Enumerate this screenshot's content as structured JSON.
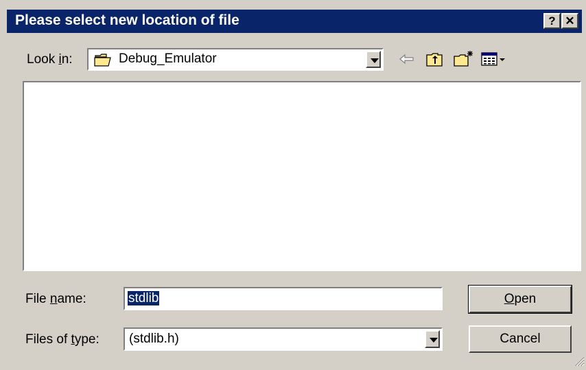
{
  "title_bar": {
    "title": "Please select new location of file",
    "help_label": "?",
    "close_label": "✕"
  },
  "look_in": {
    "label_prefix": "Look ",
    "label_underlined": "i",
    "label_suffix": "n:",
    "value": "Debug_Emulator"
  },
  "toolbar": {
    "back_icon": "arrow-left-icon",
    "up_icon": "folder-up-icon",
    "new_folder_icon": "new-folder-icon",
    "view_menu_icon": "view-details-icon"
  },
  "file_name": {
    "label_prefix": "File ",
    "label_underlined": "n",
    "label_suffix": "ame:",
    "value": "stdlib"
  },
  "files_of_type": {
    "label_prefix": "Files of ",
    "label_underlined": "t",
    "label_suffix": "ype:",
    "value": "(stdlib.h)"
  },
  "buttons": {
    "open_underlined": "O",
    "open_rest": "pen",
    "cancel": "Cancel"
  },
  "colors": {
    "title_bar": "#0a246a",
    "face": "#d4d0c8",
    "selection": "#0a246a"
  }
}
